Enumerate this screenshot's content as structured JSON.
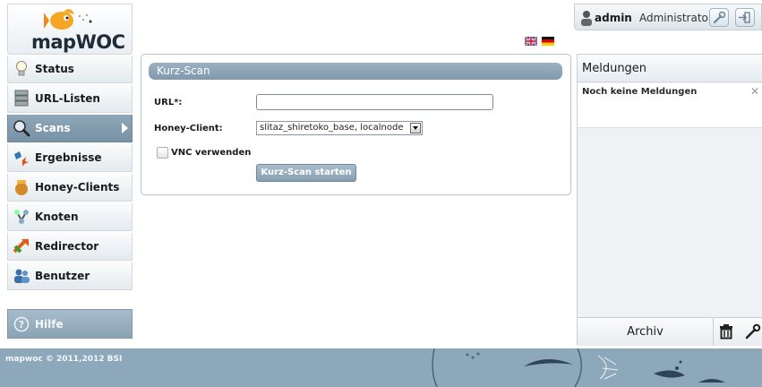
{
  "brand": {
    "logo_text": "mapWOC"
  },
  "user": {
    "name": "admin",
    "role": "Administrator"
  },
  "sidebar": {
    "items": [
      {
        "label": "Status",
        "icon": "lightbulb-icon"
      },
      {
        "label": "URL-Listen",
        "icon": "server-icon"
      },
      {
        "label": "Scans",
        "icon": "magnifier-icon",
        "active": true
      },
      {
        "label": "Ergebnisse",
        "icon": "results-icon"
      },
      {
        "label": "Honey-Clients",
        "icon": "honey-pot-icon"
      },
      {
        "label": "Knoten",
        "icon": "nodes-icon"
      },
      {
        "label": "Redirector",
        "icon": "redirect-icon"
      },
      {
        "label": "Benutzer",
        "icon": "users-icon"
      }
    ],
    "help_label": "Hilfe"
  },
  "form": {
    "title": "Kurz-Scan",
    "url_label": "URL*:",
    "url_value": "",
    "client_label": "Honey-Client:",
    "client_value": "slitaz_shiretoko_base, localnode",
    "vnc_label": "VNC verwenden",
    "vnc_checked": false,
    "start_label": "Kurz-Scan starten"
  },
  "messages": {
    "title": "Meldungen",
    "items": [
      {
        "text": "Noch keine Meldungen"
      }
    ],
    "archive_label": "Archiv"
  },
  "footer": {
    "text": "mapwoc © 2011,2012 BSI"
  },
  "colors": {
    "accent": "#8199ad",
    "footer_bg": "#8ea8bb",
    "active_nav": "#7892a6"
  }
}
